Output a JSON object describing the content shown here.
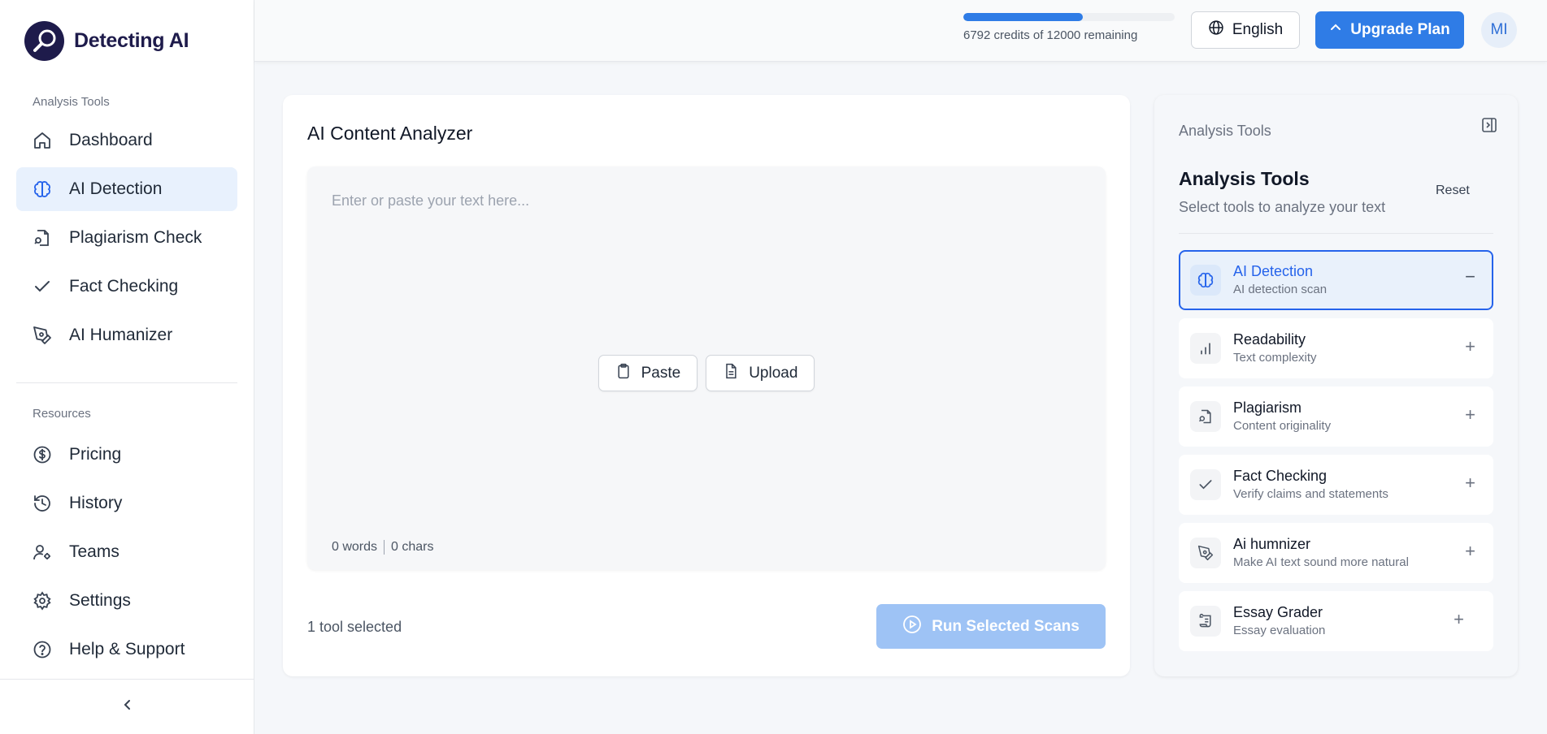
{
  "brand": {
    "name": "Detecting AI"
  },
  "sidebar": {
    "section1_label": "Analysis Tools",
    "section1_items": [
      {
        "label": "Dashboard",
        "icon": "home-icon"
      },
      {
        "label": "AI Detection",
        "icon": "brain-icon",
        "active": true
      },
      {
        "label": "Plagiarism Check",
        "icon": "file-search-icon"
      },
      {
        "label": "Fact Checking",
        "icon": "check-icon"
      },
      {
        "label": "AI Humanizer",
        "icon": "pen-tool-icon"
      }
    ],
    "section2_label": "Resources",
    "section2_items": [
      {
        "label": "Pricing",
        "icon": "dollar-circle-icon"
      },
      {
        "label": "History",
        "icon": "history-icon"
      },
      {
        "label": "Teams",
        "icon": "user-gear-icon"
      },
      {
        "label": "Settings",
        "icon": "gear-icon"
      },
      {
        "label": "Help & Support",
        "icon": "help-circle-icon"
      }
    ]
  },
  "topbar": {
    "credits_used_fraction": 0.566,
    "credits_text": "6792 credits of 12000 remaining",
    "language": "English",
    "upgrade_label": "Upgrade Plan",
    "avatar_initials": "MI"
  },
  "main": {
    "title": "AI Content Analyzer",
    "placeholder": "Enter or paste your text here...",
    "paste_label": "Paste",
    "upload_label": "Upload",
    "words": "0 words",
    "chars": "0 chars",
    "tool_selected": "1 tool selected",
    "run_label": "Run Selected Scans"
  },
  "tools_panel": {
    "small_title": "Analysis Tools",
    "title": "Analysis Tools",
    "subtitle": "Select tools to analyze your text",
    "reset_label": "Reset",
    "tools": [
      {
        "name": "AI Detection",
        "desc": "AI detection scan",
        "action": "−",
        "active": true
      },
      {
        "name": "Readability",
        "desc": "Text complexity",
        "action": "+"
      },
      {
        "name": "Plagiarism",
        "desc": "Content originality",
        "action": "+"
      },
      {
        "name": "Fact Checking",
        "desc": "Verify claims and statements",
        "action": "+"
      },
      {
        "name": "Ai humnizer",
        "desc": "Make AI text sound more natural",
        "action": "+"
      },
      {
        "name": "Essay Grader",
        "desc": "Essay evaluation",
        "action": "+"
      }
    ]
  },
  "colors": {
    "accent": "#2f7ce6",
    "brand": "#1e1b4b",
    "run_disabled": "#9ec3f5"
  }
}
